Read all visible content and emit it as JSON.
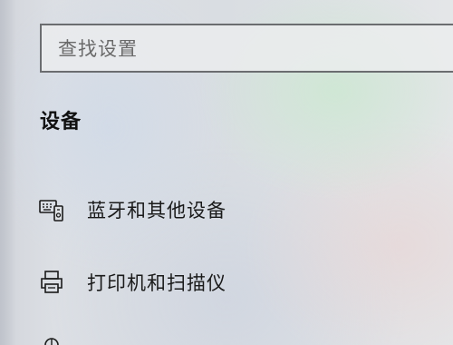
{
  "search": {
    "placeholder": "查找设置"
  },
  "section": {
    "title": "设备"
  },
  "nav": {
    "items": [
      {
        "label": "蓝牙和其他设备",
        "icon": "bluetooth-devices-icon"
      },
      {
        "label": "打印机和扫描仪",
        "icon": "printer-icon"
      }
    ],
    "partial_icon": "mouse-icon"
  },
  "colors": {
    "text": "#1a1a1a",
    "border": "#6b6d70",
    "placeholder": "#6a6a6a"
  }
}
